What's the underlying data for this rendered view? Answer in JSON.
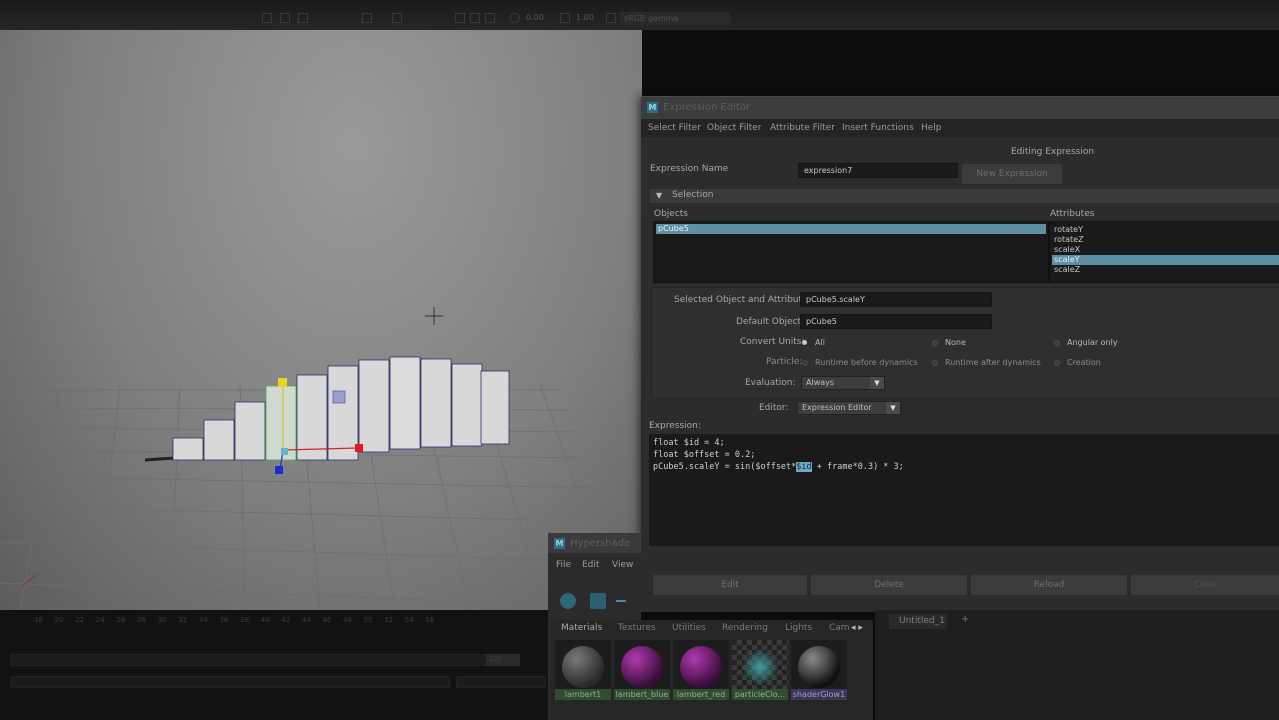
{
  "toolbar": {
    "exposure_value": "0.00",
    "gamma_value": "1.00",
    "color_space": "sRGB gamma"
  },
  "timeline": {
    "ticks": [
      "18",
      "20",
      "22",
      "24",
      "26",
      "28",
      "30",
      "32",
      "34",
      "36",
      "38",
      "40",
      "42",
      "44",
      "46",
      "48",
      "50",
      "52",
      "54",
      "56"
    ],
    "end_frame": "120"
  },
  "expression_editor": {
    "title": "Expression Editor",
    "menus": [
      "Select Filter",
      "Object Filter",
      "Attribute Filter",
      "Insert Functions",
      "Help"
    ],
    "mode_label": "Editing Expression",
    "expression_name_label": "Expression Name",
    "expression_name_value": "expression7",
    "new_expression_button": "New Expression",
    "selection_section": "Selection",
    "objects_label": "Objects",
    "objects": [
      {
        "name": "pCube5",
        "selected": true
      }
    ],
    "attributes_label": "Attributes",
    "attributes": [
      {
        "name": "rotateY",
        "selected": false
      },
      {
        "name": "rotateZ",
        "selected": false
      },
      {
        "name": "scaleX",
        "selected": false
      },
      {
        "name": "scaleY",
        "selected": true
      },
      {
        "name": "scaleZ",
        "selected": false
      }
    ],
    "selected_obj_attr_label": "Selected Object and Attribute:",
    "selected_obj_attr_value": "pCube5.scaleY",
    "default_object_label": "Default Object:",
    "default_object_value": "pCube5",
    "convert_units_label": "Convert Units:",
    "convert_units_options": [
      {
        "label": "All",
        "checked": true
      },
      {
        "label": "None",
        "checked": false
      },
      {
        "label": "Angular only",
        "checked": false
      }
    ],
    "particle_label": "Particle:",
    "particle_options": [
      {
        "label": "Runtime before dynamics",
        "checked": true
      },
      {
        "label": "Runtime after dynamics",
        "checked": false
      },
      {
        "label": "Creation",
        "checked": false
      }
    ],
    "evaluation_label": "Evaluation:",
    "evaluation_value": "Always",
    "editor_label": "Editor:",
    "editor_value": "Expression Editor",
    "expression_label": "Expression:",
    "code": {
      "line1": "float $id = 4;",
      "line2": "float $offset = 0.2;",
      "line3_before": "pCube5.scaleY = sin($offset*",
      "line3_highlight": "$id",
      "line3_after": " + frame*0.3) * 3;"
    },
    "buttons": {
      "edit": "Edit",
      "delete": "Delete",
      "reload": "Reload",
      "clear": "Clear"
    }
  },
  "hypershade": {
    "title": "Hypershade",
    "menus": [
      "File",
      "Edit",
      "View"
    ],
    "tabs": [
      "Materials",
      "Textures",
      "Utilities",
      "Rendering",
      "Lights",
      "Cam"
    ],
    "materials": [
      {
        "name": "lambert1",
        "color": "#4a4a4a"
      },
      {
        "name": "lambert_blue",
        "color": "#6a1e6a"
      },
      {
        "name": "lambert_red",
        "color": "#6a1e6a"
      },
      {
        "name": "particleClo...",
        "color": "#2b5b5b"
      },
      {
        "name": "shaderGlow1",
        "color": "#3a3a3a"
      }
    ],
    "graph_tab": "Untitled_1"
  }
}
